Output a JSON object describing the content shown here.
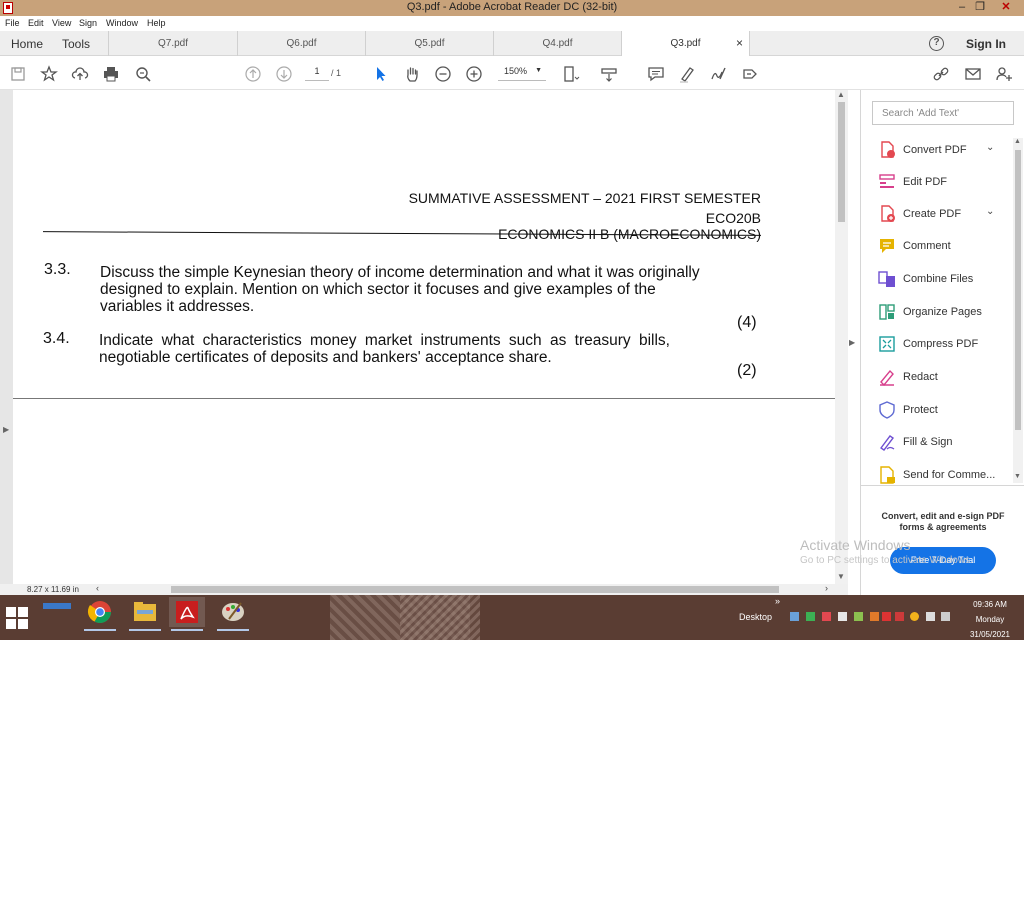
{
  "window": {
    "title": "Q3.pdf - Adobe Acrobat Reader DC (32-bit)",
    "minimize": "–",
    "maximize": "❐",
    "close": "✕"
  },
  "menu": [
    "File",
    "Edit",
    "View",
    "Sign",
    "Window",
    "Help"
  ],
  "nav": {
    "home": "Home",
    "tools": "Tools"
  },
  "tabs": [
    {
      "label": "Q7.pdf",
      "active": false
    },
    {
      "label": "Q6.pdf",
      "active": false
    },
    {
      "label": "Q5.pdf",
      "active": false
    },
    {
      "label": "Q4.pdf",
      "active": false
    },
    {
      "label": "Q3.pdf",
      "active": true
    }
  ],
  "tab_close": "×",
  "help_label": "?",
  "sign_in": "Sign In",
  "toolbar": {
    "page_current": "1",
    "page_total": "/ 1",
    "zoom": "150%",
    "icons": [
      "save-icon",
      "bookmark-star-icon",
      "upload-cloud-icon",
      "print-icon",
      "search-zoom-icon",
      "page-up-icon",
      "page-down-icon",
      "select-arrow-icon",
      "hand-icon",
      "zoom-out-icon",
      "zoom-in-icon",
      "fit-page-icon",
      "scroll-mode-icon",
      "comment-icon",
      "highlight-icon",
      "sign-icon",
      "more-tools-icon",
      "share-link-icon",
      "email-icon",
      "add-user-icon"
    ]
  },
  "document": {
    "header_line1": "SUMMATIVE ASSESSMENT – 2021 FIRST SEMESTER",
    "header_line2": "ECO20B",
    "header_line3": "ECONOMICS II B (MACROECONOMICS)",
    "q33": {
      "number": "3.3.",
      "line1": "Discuss the simple Keynesian theory of income determination and what it was originally",
      "line2": "designed to explain. Mention on which sector it focuses and give examples of the",
      "line3": "variables it addresses.",
      "marks": "(4)"
    },
    "q34": {
      "number": "3.4.",
      "line1": "Indicate what characteristics money market instruments such as treasury bills,",
      "line2": "negotiable certificates of deposits and bankers' acceptance share.",
      "marks": "(2)"
    },
    "page_size": "8.27 x 11.69 in"
  },
  "tools_pane": {
    "search_placeholder": "Search 'Add Text'",
    "items": [
      {
        "label": "Convert PDF",
        "icon": "convert-pdf-icon",
        "color": "#e34850",
        "expandable": true
      },
      {
        "label": "Edit PDF",
        "icon": "edit-pdf-icon",
        "color": "#d73f8c",
        "expandable": false
      },
      {
        "label": "Create PDF",
        "icon": "create-pdf-icon",
        "color": "#e34850",
        "expandable": true
      },
      {
        "label": "Comment",
        "icon": "comment-icon",
        "color": "#e5b300",
        "expandable": false
      },
      {
        "label": "Combine Files",
        "icon": "combine-files-icon",
        "color": "#6e4fd1",
        "expandable": false
      },
      {
        "label": "Organize Pages",
        "icon": "organize-pages-icon",
        "color": "#2d9d78",
        "expandable": false
      },
      {
        "label": "Compress PDF",
        "icon": "compress-pdf-icon",
        "color": "#1a9d9d",
        "expandable": false
      },
      {
        "label": "Redact",
        "icon": "redact-icon",
        "color": "#d73f8c",
        "expandable": false
      },
      {
        "label": "Protect",
        "icon": "protect-icon",
        "color": "#5e6ad2",
        "expandable": false
      },
      {
        "label": "Fill & Sign",
        "icon": "fill-sign-icon",
        "color": "#6e4fd1",
        "expandable": false
      },
      {
        "label": "Send for Comme...",
        "icon": "send-for-comment-icon",
        "color": "#e5b300",
        "expandable": false
      }
    ],
    "promo_text": "Convert, edit and e-sign PDF forms & agreements",
    "trial_button": "Free 7-Day Trial"
  },
  "watermark": {
    "line1": "Activate Windows",
    "line2": "Go to PC settings to activate Windows."
  },
  "taskbar": {
    "desktop_label": "Desktop",
    "chevron": "»",
    "time": "09:36 AM",
    "day": "Monday",
    "date": "31/05/2021",
    "apps": [
      "chrome-icon",
      "file-explorer-icon",
      "acrobat-icon",
      "paint-icon"
    ]
  },
  "colors": {
    "accent": "#1473e6",
    "titlebar": "#c8a27a",
    "taskbar": "#5a3d33"
  }
}
